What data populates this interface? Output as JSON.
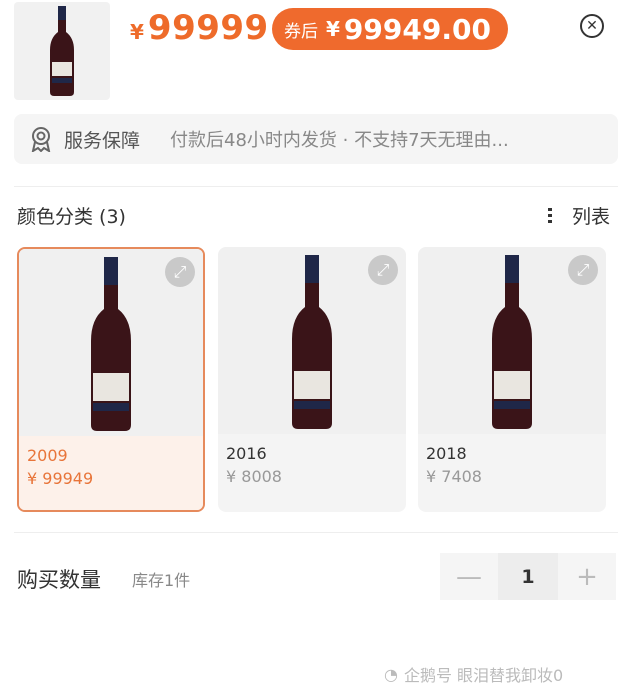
{
  "header": {
    "price_symbol": "¥",
    "price": "99999",
    "coupon_tag": "券后",
    "coupon_symbol": "¥",
    "coupon_price": "99949.00"
  },
  "service": {
    "label": "服务保障",
    "description": "付款后48小时内发货 · 不支持7天无理由..."
  },
  "category": {
    "title": "颜色分类 (3)",
    "list_toggle": "列表"
  },
  "variants": [
    {
      "year": "2009",
      "price": "¥ 99949",
      "selected": true
    },
    {
      "year": "2016",
      "price": "¥ 8008",
      "selected": false
    },
    {
      "year": "2018",
      "price": "¥ 7408",
      "selected": false
    }
  ],
  "quantity": {
    "label": "购买数量",
    "stock": "库存1件",
    "minus": "—",
    "value": "1",
    "plus": "+"
  },
  "watermark": "企鹅号 眼泪替我卸妆0",
  "colors": {
    "accent": "#ef6a2d",
    "selected_border": "#e68a5c",
    "bottle": "#3a1418"
  }
}
